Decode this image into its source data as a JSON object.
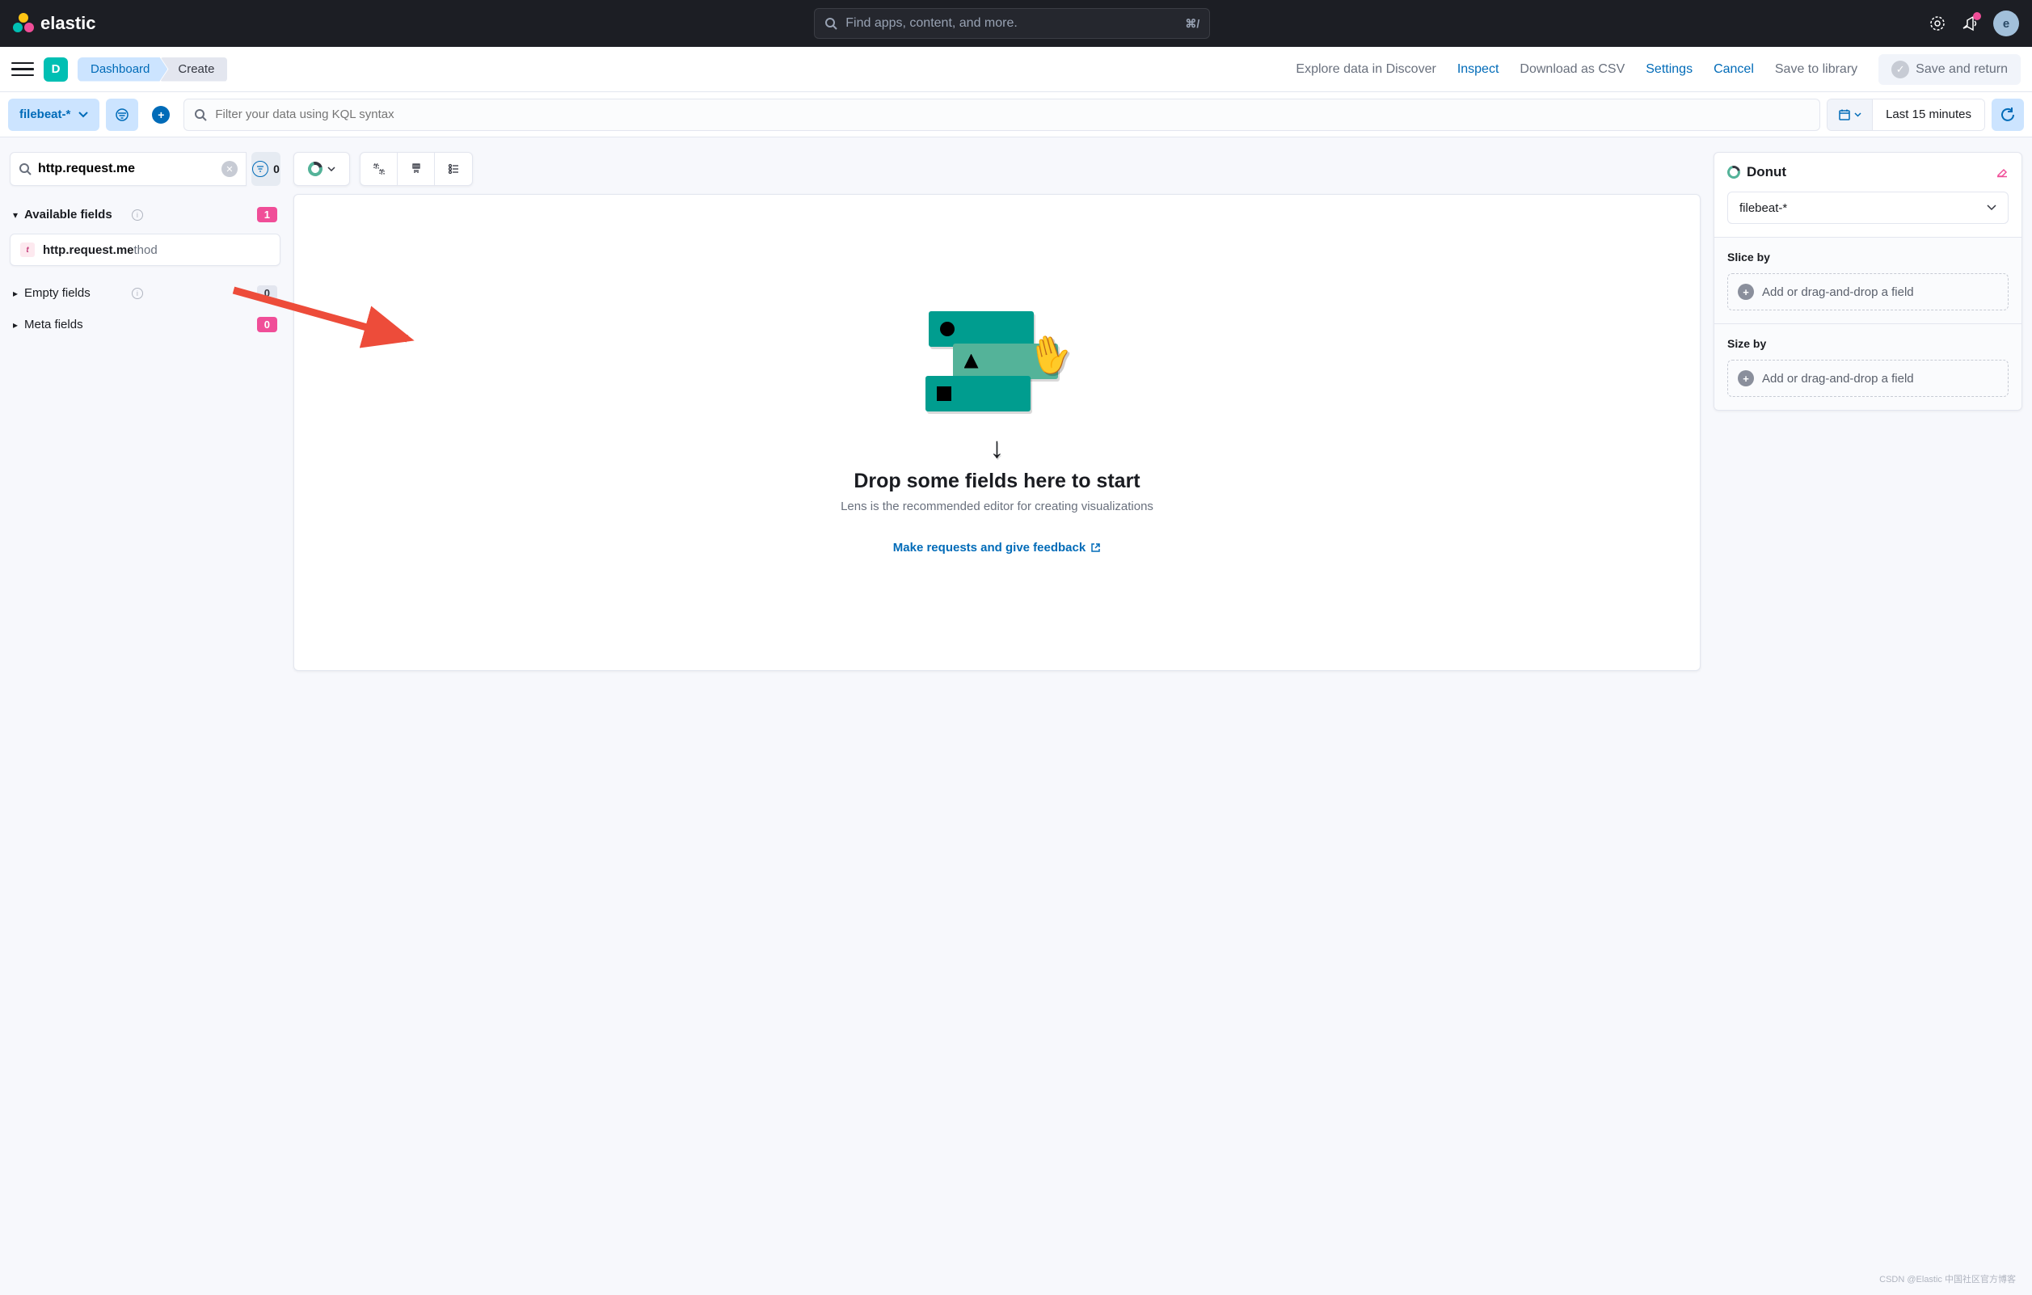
{
  "header": {
    "brand": "elastic",
    "search_placeholder": "Find apps, content, and more.",
    "shortcut": "⌘/",
    "avatar_letter": "e"
  },
  "subheader": {
    "app_letter": "D",
    "breadcrumb": {
      "dashboard": "Dashboard",
      "create": "Create"
    },
    "actions": {
      "explore": "Explore data in Discover",
      "inspect": "Inspect",
      "download": "Download as CSV",
      "settings": "Settings",
      "cancel": "Cancel",
      "save_library": "Save to library",
      "save_return": "Save and return"
    }
  },
  "filterbar": {
    "data_view": "filebeat-*",
    "kql_placeholder": "Filter your data using KQL syntax",
    "time_range": "Last 15 minutes"
  },
  "fields": {
    "search_value": "http.request.me",
    "filter_count": "0",
    "available": {
      "label": "Available fields",
      "count": "1"
    },
    "field_item": {
      "bold": "http.request.me",
      "rest": "thod"
    },
    "empty": {
      "label": "Empty fields",
      "count": "0"
    },
    "meta": {
      "label": "Meta fields",
      "count": "0"
    }
  },
  "canvas": {
    "title": "Drop some fields here to start",
    "subtitle": "Lens is the recommended editor for creating visualizations",
    "feedback": "Make requests and give feedback"
  },
  "config": {
    "viz_type": "Donut",
    "data_view": "filebeat-*",
    "slice_by": {
      "label": "Slice by",
      "placeholder": "Add or drag-and-drop a field"
    },
    "size_by": {
      "label": "Size by",
      "placeholder": "Add or drag-and-drop a field"
    }
  },
  "watermark": "CSDN @Elastic 中国社区官方博客"
}
